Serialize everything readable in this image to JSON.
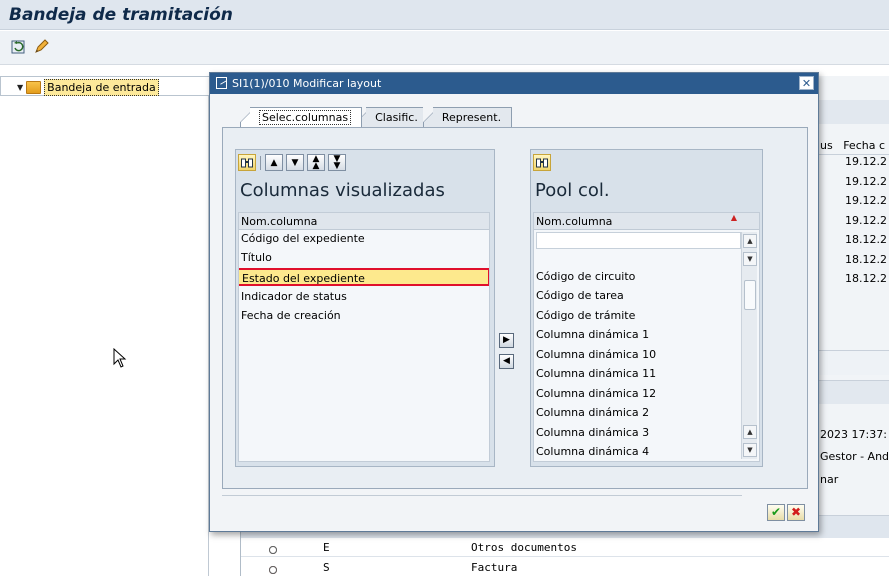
{
  "screen": {
    "title": "Bandeja de tramitación"
  },
  "tree": {
    "node_label": "Bandeja de entrada"
  },
  "background_right": {
    "header_cols": [
      "us",
      "Fecha c"
    ],
    "dates": [
      "19.12.2",
      "19.12.2",
      "19.12.2",
      "19.12.2",
      "18.12.2",
      "18.12.2",
      "18.12.2"
    ],
    "detail_lines": [
      "2023 17:37:",
      "Gestor - And",
      "nar"
    ]
  },
  "bottom_grid": {
    "rows": [
      {
        "code": "E",
        "desc": "Otros documentos",
        "lights": [
          "white",
          "white",
          "white"
        ]
      },
      {
        "code": "S",
        "desc": "Factura",
        "lights": [
          "red",
          "white",
          "white"
        ]
      }
    ]
  },
  "dialog": {
    "title": "SI1(1)/010 Modificar layout",
    "close_label": "✕",
    "tabs": [
      {
        "label": "Selec.columnas",
        "active": true
      },
      {
        "label": "Clasific.",
        "active": false
      },
      {
        "label": "Represent.",
        "active": false
      }
    ],
    "left_panel": {
      "title": "Columnas visualizadas",
      "header": "Nom.columna",
      "items": [
        {
          "label": "Código del expediente",
          "selected": false
        },
        {
          "label": "Título",
          "selected": false
        },
        {
          "label": "Estado del expediente",
          "selected": true
        },
        {
          "label": "Indicador de status",
          "selected": false
        },
        {
          "label": "Fecha de creación",
          "selected": false
        }
      ]
    },
    "right_panel": {
      "title": "Pool col.",
      "header": "Nom.columna",
      "items": [
        "Código de circuito",
        "Código de tarea",
        "Código de trámite",
        "Columna dinámica 1",
        "Columna dinámica 10",
        "Columna dinámica 11",
        "Columna dinámica 12",
        "Columna dinámica 2",
        "Columna dinámica 3",
        "Columna dinámica 4"
      ]
    },
    "ok_label": "✔",
    "cancel_label": "✖"
  },
  "colors": {
    "dialog_title_bg": "#2c5b8e",
    "selection_fill": "#fde98d",
    "selection_border": "#e0102c"
  }
}
